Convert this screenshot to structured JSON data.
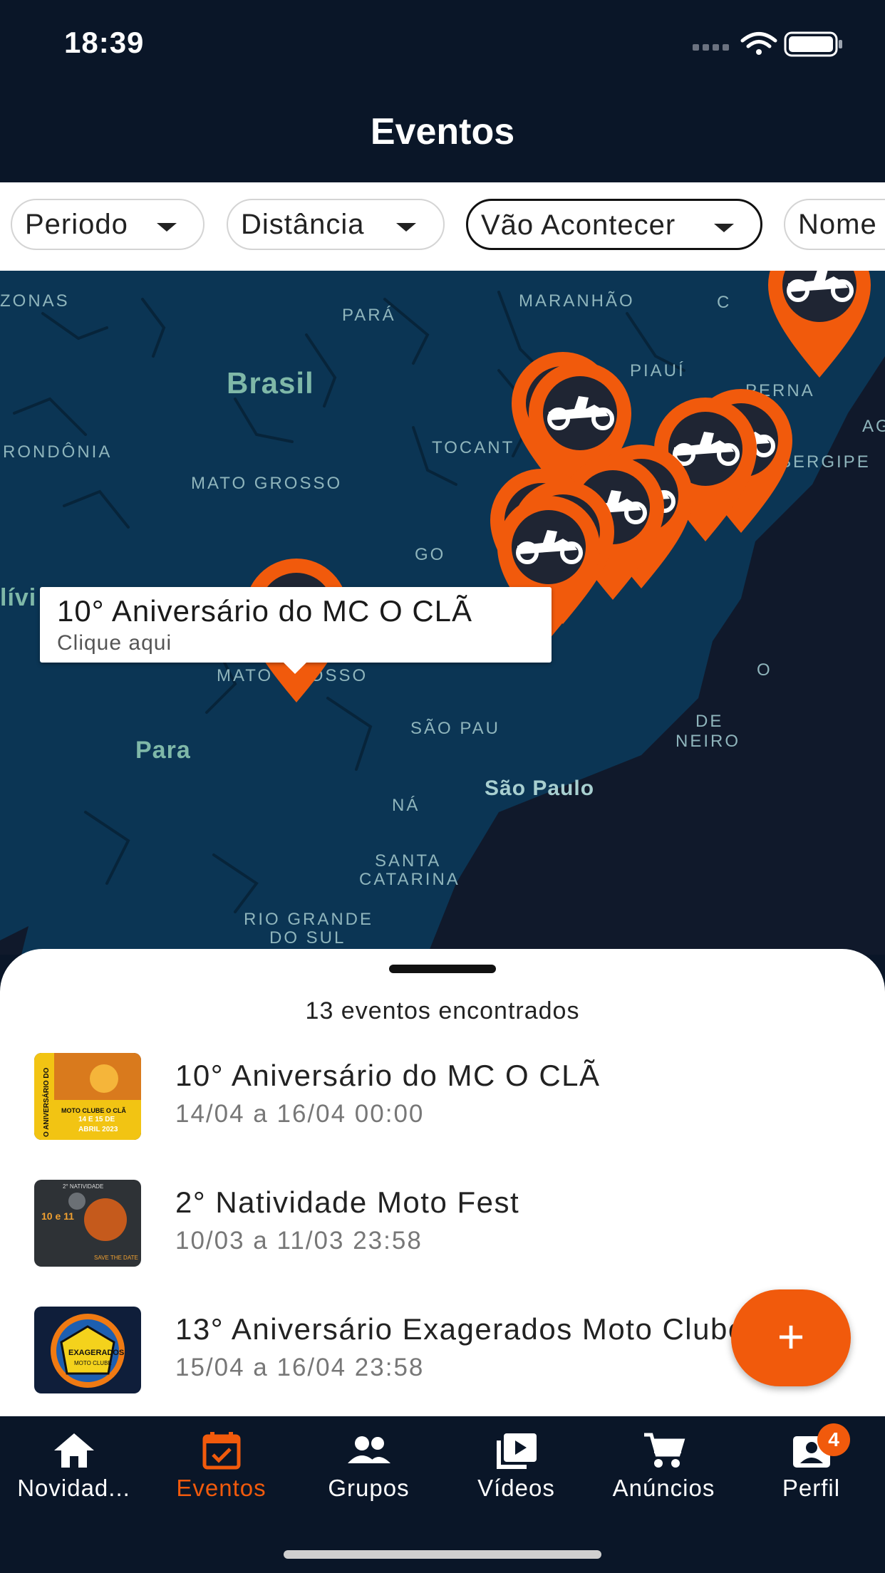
{
  "status_bar": {
    "time": "18:39"
  },
  "header": {
    "title": "Eventos"
  },
  "filters": [
    {
      "label": "Periodo"
    },
    {
      "label": "Distância"
    },
    {
      "label": "Vão Acontecer",
      "active": true
    },
    {
      "label": "Nome"
    }
  ],
  "map": {
    "labels": [
      "ZONAS",
      "PARÁ",
      "MARANHÃO",
      "Brasil",
      "PIAUÍ",
      "PERNA",
      "RONDÔNIA",
      "TOCANT",
      "SERGIPE",
      "MATO GROSSO",
      "GO",
      "lívi",
      "MATO GROSSO",
      "Para",
      "SÃO PAU",
      "São Paulo",
      "NÁ",
      "DE",
      "NEIRO",
      "SANTA",
      "CATARINA",
      "RIO GRANDE",
      "DO SUL",
      "C",
      "AG",
      "O"
    ],
    "marker_icon": "motorcycle-icon",
    "marker_color": "#F15A0C",
    "water_color": "#0B3554",
    "ocean_color": "#10192B"
  },
  "callout": {
    "title": "10° Aniversário do MC O CLÃ",
    "subtitle": "Clique aqui"
  },
  "sheet": {
    "count_text": "13 eventos encontrados",
    "events": [
      {
        "title": "10° Aniversário do MC O CLÃ",
        "date": "14/04 a 16/04 00:00"
      },
      {
        "title": "2° Natividade Moto Fest",
        "date": "10/03 a 11/03 23:58"
      },
      {
        "title": "13° Aniversário Exagerados Moto Clube",
        "date": "15/04 a 16/04 23:58"
      }
    ],
    "thumb_texts": {
      "t1": [
        "O ANIVERSÁRIO DO",
        "MOTO CLUBE O CLÃ",
        "14 E 15 DE",
        "ABRIL 2023"
      ],
      "t2": [
        "2° NATIVIDADE",
        "10 e 11",
        "SAVE THE DATE"
      ],
      "t3": [
        "EXAGERADOS",
        "MOTO CLUBE"
      ]
    }
  },
  "fab": {
    "label": "+"
  },
  "tabbar": {
    "tabs": [
      {
        "label": "Novidad...",
        "icon": "home-icon"
      },
      {
        "label": "Eventos",
        "icon": "calendar-check-icon",
        "active": true
      },
      {
        "label": "Grupos",
        "icon": "people-icon"
      },
      {
        "label": "Vídeos",
        "icon": "video-library-icon"
      },
      {
        "label": "Anúncios",
        "icon": "cart-icon"
      },
      {
        "label": "Perfil",
        "icon": "profile-card-icon",
        "badge": "4"
      }
    ]
  },
  "colors": {
    "accent": "#F15A0C",
    "navy": "#0A1628"
  }
}
